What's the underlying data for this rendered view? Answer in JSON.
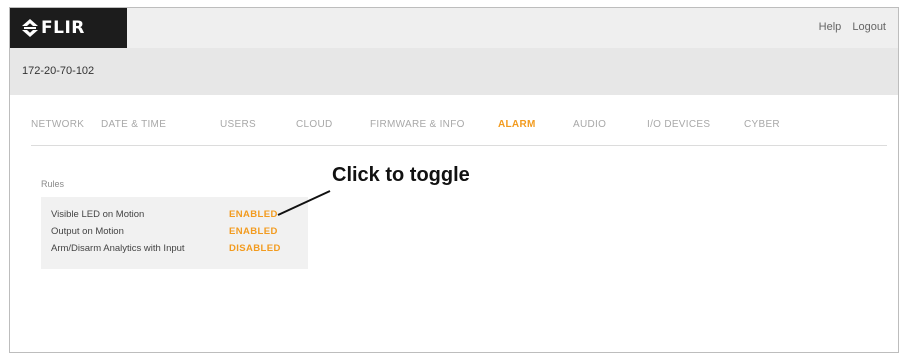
{
  "brand": {
    "name": "FLIR",
    "icon": "flir-diamond-icon"
  },
  "header": {
    "links": [
      "Help",
      "Logout"
    ]
  },
  "device": {
    "name": "172-20-70-102"
  },
  "nav": {
    "tabs": [
      "NETWORK",
      "DATE & TIME",
      "USERS",
      "CLOUD",
      "FIRMWARE & INFO",
      "ALARM",
      "AUDIO",
      "I/O DEVICES",
      "CYBER"
    ],
    "active": "ALARM"
  },
  "rules": {
    "label": "Rules",
    "items": [
      {
        "name": "Visible LED on Motion",
        "status": "ENABLED"
      },
      {
        "name": "Output on Motion",
        "status": "ENABLED"
      },
      {
        "name": "Arm/Disarm Analytics with Input",
        "status": "DISABLED"
      }
    ]
  },
  "annotation": {
    "text": "Click to toggle"
  },
  "colors": {
    "accent": "#f29b1f",
    "logo_bg": "#1c1c1c",
    "topbar_bg": "#efefef",
    "devicebar_bg": "#e7e7e7"
  }
}
